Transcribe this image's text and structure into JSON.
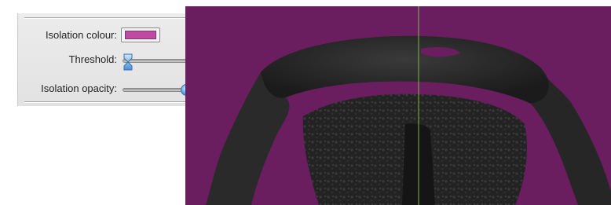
{
  "panel": {
    "colour_label": "Isolation colour:",
    "colour_value": "#c04aa3",
    "threshold_label": "Threshold:",
    "threshold_level": 0.0,
    "opacity_label": "Isolation opacity:",
    "opacity_level": 0.55
  },
  "viewport": {
    "background_color": "#6a1e60",
    "crosshair_color": "#7bb84a"
  }
}
